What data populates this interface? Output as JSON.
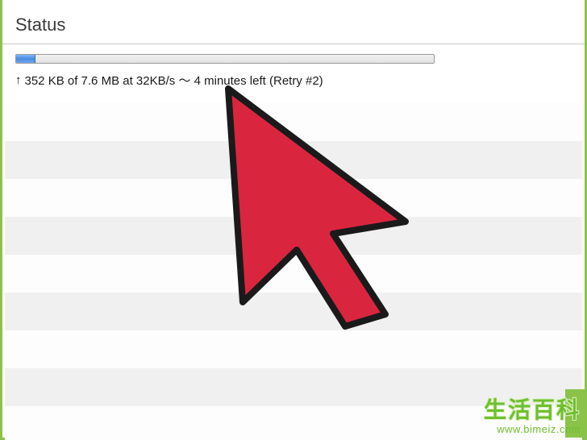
{
  "header": {
    "title": "Status"
  },
  "progress": {
    "percent": 4.6,
    "direction_icon": "upload-arrow-icon",
    "label": "352 KB of 7.6 MB at 32KB/s ～ 4 minutes left (Retry #2)"
  },
  "colors": {
    "frame": "#8bc34a",
    "progress_fill": "#5a96e8",
    "cursor_fill": "#d9263e",
    "cursor_stroke": "#1a1a1a"
  },
  "watermark": {
    "text_cn": "生活百科",
    "url": "www.bimeiz.com"
  }
}
